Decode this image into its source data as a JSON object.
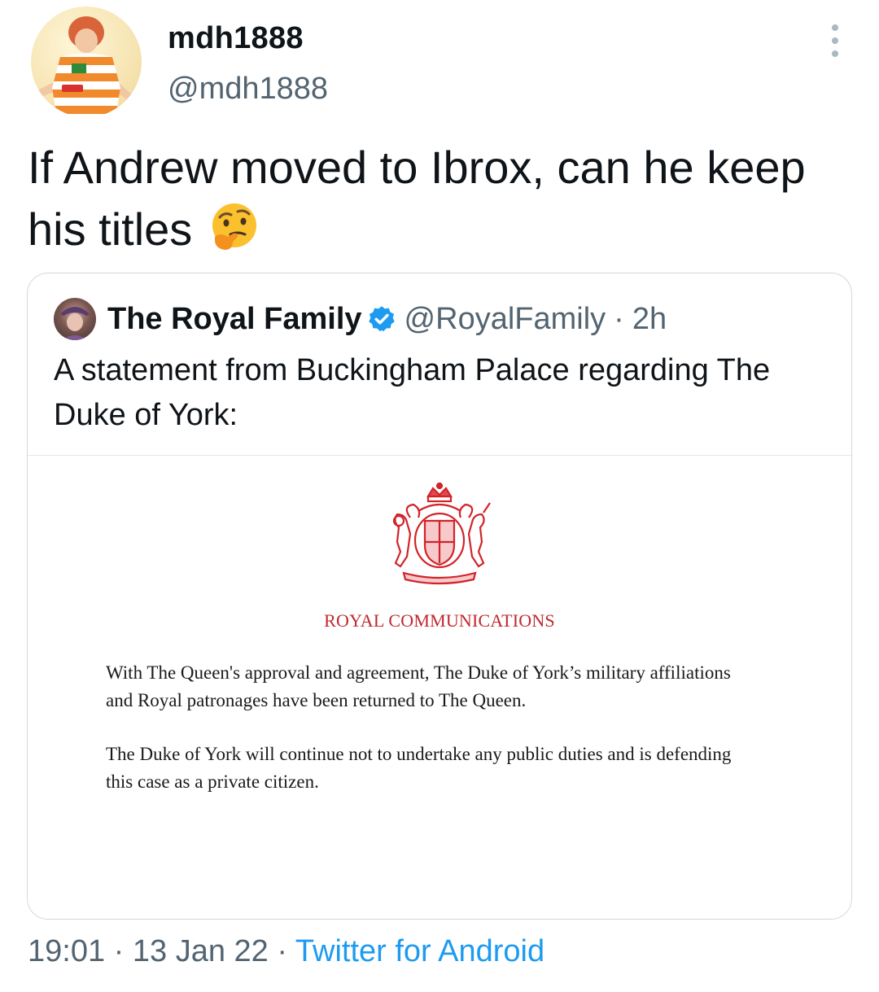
{
  "author": {
    "display_name": "mdh1888",
    "handle": "@mdh1888"
  },
  "tweet": {
    "text": "If Andrew moved to Ibrox, can he keep his titles",
    "emoji": "thinking-face-icon"
  },
  "quoted_tweet": {
    "display_name": "The Royal Family",
    "verified": true,
    "handle": "@RoyalFamily",
    "separator": "·",
    "time_ago": "2h",
    "text": "A statement from Buckingham Palace regarding The Duke of York:",
    "image": {
      "heading": "ROYAL COMMUNICATIONS",
      "paragraph_1": "With The Queen's approval and agreement, The Duke of York’s military affiliations and Royal patronages have been returned to The Queen.",
      "paragraph_2": "The Duke of York will continue not to undertake any public duties and is defending this case as a private citizen."
    }
  },
  "meta": {
    "time": "19:01",
    "separator": "·",
    "date": "13 Jan 22",
    "source": "Twitter for Android"
  },
  "colors": {
    "link_blue": "#1d9bf0",
    "secondary_text": "#536471",
    "crest_red": "#c0282d",
    "border": "#cfd9de"
  }
}
